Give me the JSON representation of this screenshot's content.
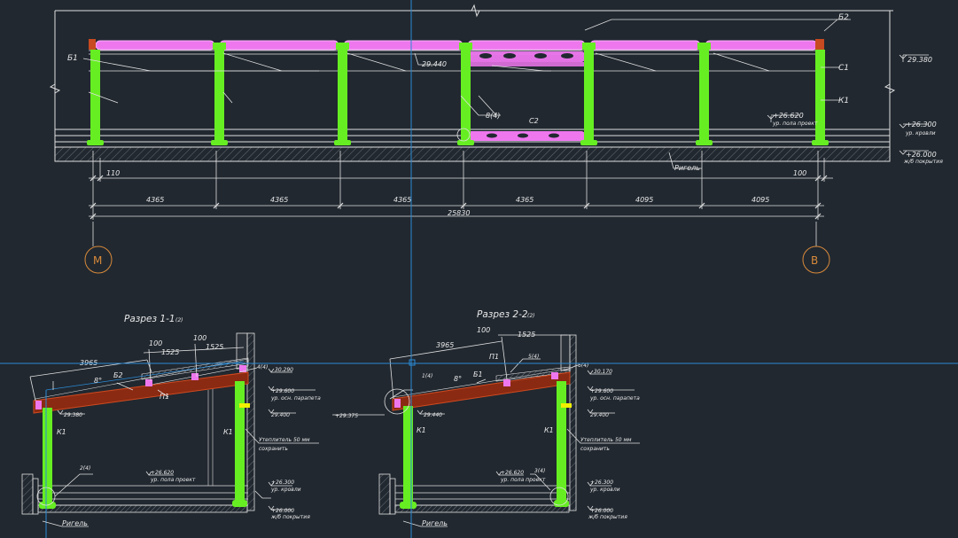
{
  "colors": {
    "background": "#212830",
    "line": "#e0e0e0",
    "column": "#66ee22",
    "beam": "#ee77ee",
    "rafter": "#8a2a12",
    "rafter_end": "#d04a20",
    "crosshair": "#2a8ad4",
    "axis_bubble": "#d98a3a",
    "ground": "#3a3f45"
  },
  "elevation": {
    "labels": {
      "b2": "Б2",
      "b1": "Б1",
      "c1": "С1",
      "k1": "К1",
      "c2": "С2",
      "node8": "8(4)",
      "rigel": "Ригель"
    },
    "levels": {
      "l29380": "29.380",
      "l29440": "29.440",
      "l26620": "+26.620",
      "l26620_note": "ур. пола проект",
      "l26300": "+26.300",
      "l26300_note": "ур. кровли",
      "l26000": "+26.000",
      "l26000_note": "ж/б покрытия"
    },
    "dims": {
      "left_offset": "110",
      "right_offset": "100",
      "spans": [
        "4365",
        "4365",
        "4365",
        "4365",
        "4095",
        "4095"
      ],
      "total": "25830"
    },
    "axes": [
      "М",
      "В"
    ]
  },
  "section11": {
    "title": "Разрез 1-1",
    "title_ref": "(2)",
    "dim_slope": "3965",
    "dim_100a": "100",
    "dim_1525a": "1525",
    "dim_100b": "100",
    "dim_1525b": "1525",
    "angle": "8°",
    "b2": "Б2",
    "p1": "П1",
    "k1_left": "К1",
    "k1_right": "К1",
    "node4": "4(4)",
    "node2": "2(4)",
    "lvl_30290": "30.290",
    "lvl_29600": "+29.600",
    "lvl_29600_note": "ур. осн. парапета",
    "lvl_29400": "29.400",
    "lvl_29380": "29.380",
    "insul1": "Утеплитель 50 мм",
    "insul2": "сохранить",
    "lvl_26620": "+26.620",
    "lvl_26620_note": "ур. пола проект",
    "lvl_26300": "+26.300",
    "lvl_26300_note": "ур. кровли",
    "lvl_26000": "+26.000",
    "lvl_26000_note": "ж/б покрытия",
    "rigel": "Ригель"
  },
  "section22": {
    "title": "Разрез 2-2",
    "title_ref": "(2)",
    "dim_slope": "3965",
    "dim_100": "100",
    "dim_1525": "1525",
    "angle": "8°",
    "b1": "Б1",
    "p1": "П1",
    "node1": "1(4)",
    "node5": "5(4)",
    "node6": "6(4)",
    "node3": "3(4)",
    "k1_left": "К1",
    "k1_right": "К1",
    "lvl_30170": "30.170",
    "lvl_29600": "+29.600",
    "lvl_29600_note": "ур. осн. парапета",
    "lvl_29400": "29.400",
    "lvl_29440": "29.440",
    "lvl_29375": "+29.375",
    "insul1": "Утеплитель 50 мм",
    "insul2": "сохранить",
    "lvl_26620": "+26.620",
    "lvl_26620_note": "ур. пола проект",
    "lvl_26300": "+26.300",
    "lvl_26300_note": "ур. кровли",
    "lvl_26000": "+26.000",
    "lvl_26000_note": "ж/б покрытия",
    "rigel": "Ригель"
  }
}
